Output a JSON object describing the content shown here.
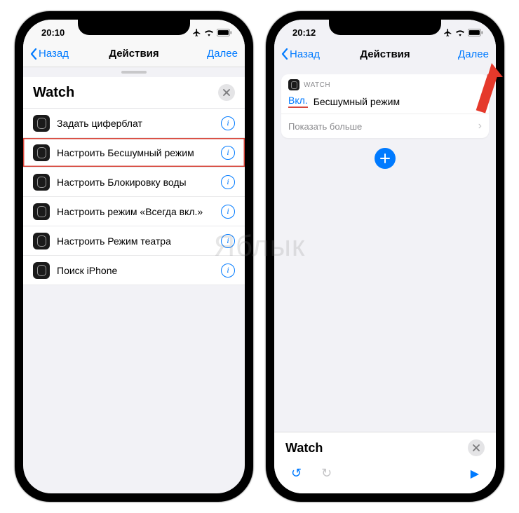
{
  "watermark": "Яблык",
  "left": {
    "status": {
      "time": "20:10"
    },
    "nav": {
      "back": "Назад",
      "title": "Действия",
      "next": "Далее"
    },
    "search": {
      "query": "Watch"
    },
    "actions": [
      {
        "label": "Задать циферблат",
        "highlighted": false
      },
      {
        "label": "Настроить Бесшумный режим",
        "highlighted": true
      },
      {
        "label": "Настроить Блокировку воды",
        "highlighted": false
      },
      {
        "label": "Настроить режим «Всегда вкл.»",
        "highlighted": false
      },
      {
        "label": "Настроить Режим театра",
        "highlighted": false
      },
      {
        "label": "Поиск iPhone",
        "highlighted": false
      }
    ]
  },
  "right": {
    "status": {
      "time": "20:12"
    },
    "nav": {
      "back": "Назад",
      "title": "Действия",
      "next": "Далее"
    },
    "card": {
      "app": "WATCH",
      "toggle_value": "Вкл.",
      "action_name": "Бесшумный режим",
      "more_label": "Показать больше"
    },
    "bottom": {
      "title": "Watch"
    }
  }
}
